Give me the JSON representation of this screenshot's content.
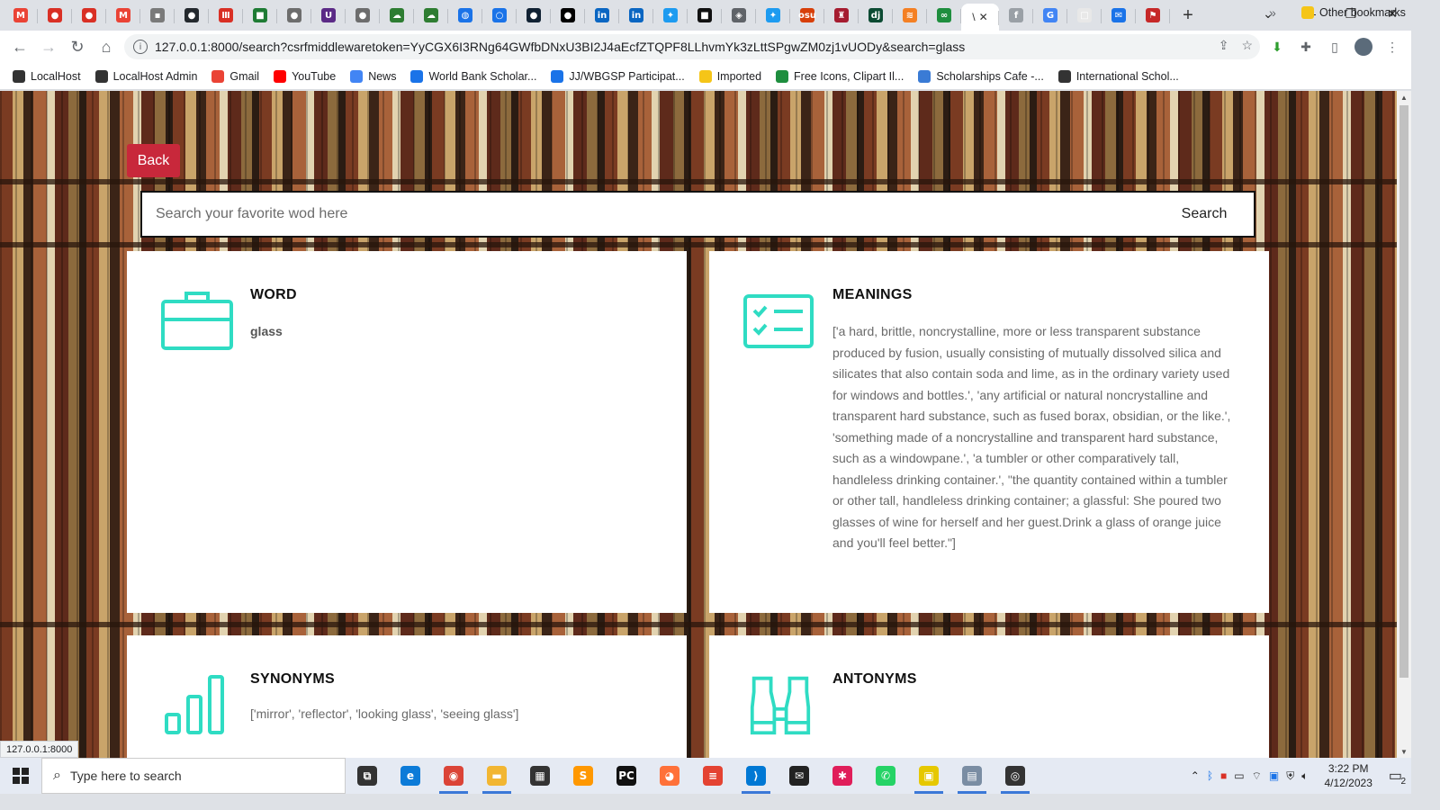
{
  "browser": {
    "tabs": [
      {
        "icon": "gmail-icon",
        "color": "#ea4335",
        "glyph": "M"
      },
      {
        "icon": "red-circle-icon",
        "color": "#d93025",
        "glyph": "●"
      },
      {
        "icon": "red-circle-icon",
        "color": "#d93025",
        "glyph": "●"
      },
      {
        "icon": "gmail-icon",
        "color": "#ea4335",
        "glyph": "M"
      },
      {
        "icon": "doc-icon",
        "color": "#7a7a7a",
        "glyph": "▪"
      },
      {
        "icon": "github-icon",
        "color": "#24292e",
        "glyph": "●"
      },
      {
        "icon": "bars-icon",
        "color": "#d93025",
        "glyph": "Ⅲ"
      },
      {
        "icon": "green-square-icon",
        "color": "#1e7b34",
        "glyph": "■"
      },
      {
        "icon": "gray-circle-icon",
        "color": "#6d6d6d",
        "glyph": "●"
      },
      {
        "icon": "u-icon",
        "color": "#5b2a86",
        "glyph": "U"
      },
      {
        "icon": "gray-circle-icon",
        "color": "#6d6d6d",
        "glyph": "●"
      },
      {
        "icon": "cloud-icon",
        "color": "#2e7d32",
        "glyph": "☁"
      },
      {
        "icon": "cloud-icon",
        "color": "#2e7d32",
        "glyph": "☁"
      },
      {
        "icon": "globe-icon",
        "color": "#1a73e8",
        "glyph": "◍"
      },
      {
        "icon": "blue-ring-icon",
        "color": "#1a73e8",
        "glyph": "○"
      },
      {
        "icon": "dark-circle-icon",
        "color": "#123",
        "glyph": "●"
      },
      {
        "icon": "medium-icon",
        "color": "#000",
        "glyph": "●"
      },
      {
        "icon": "linkedin-icon",
        "color": "#0a66c2",
        "glyph": "in"
      },
      {
        "icon": "linkedin-icon",
        "color": "#0a66c2",
        "glyph": "in"
      },
      {
        "icon": "twitter-icon",
        "color": "#1d9bf0",
        "glyph": "✦"
      },
      {
        "icon": "black-square-icon",
        "color": "#111",
        "glyph": "■"
      },
      {
        "icon": "shield-icon",
        "color": "#5f6368",
        "glyph": "◈"
      },
      {
        "icon": "twitter-icon",
        "color": "#1d9bf0",
        "glyph": "✦"
      },
      {
        "icon": "osu-icon",
        "color": "#d73f09",
        "glyph": "osu"
      },
      {
        "icon": "crest-icon",
        "color": "#a51c30",
        "glyph": "♜"
      },
      {
        "icon": "django-icon",
        "color": "#0c4b33",
        "glyph": "dj"
      },
      {
        "icon": "orange-icon",
        "color": "#f48024",
        "glyph": "≋"
      },
      {
        "icon": "green-link-icon",
        "color": "#1e8e3e",
        "glyph": "∞"
      }
    ],
    "active_tab": {
      "title": "\\",
      "close": "✕"
    },
    "tabs_after": [
      {
        "icon": "facebook-icon",
        "color": "#9aa0a6",
        "glyph": "f"
      },
      {
        "icon": "google-icon",
        "color": "#4285f4",
        "glyph": "G"
      },
      {
        "icon": "white-square-icon",
        "color": "#e8e8e8",
        "glyph": "□"
      },
      {
        "icon": "inbox-icon",
        "color": "#1a73e8",
        "glyph": "✉"
      },
      {
        "icon": "flag-icon",
        "color": "#c62828",
        "glyph": "⚑"
      }
    ],
    "new_tab": "+",
    "url": "127.0.0.1:8000/search?csrfmiddlewaretoken=YyCGX6I3RNg64GWfbDNxU3BI2J4aEcfZTQPF8LLhvmYk3zLttSPgwZM0zj1vUODy&search=glass",
    "status_url": "127.0.0.1:8000",
    "bookmarks": [
      {
        "label": "LocalHost",
        "color": "#333"
      },
      {
        "label": "LocalHost Admin",
        "color": "#333"
      },
      {
        "label": "Gmail",
        "color": "#ea4335"
      },
      {
        "label": "YouTube",
        "color": "#ff0000"
      },
      {
        "label": "News",
        "color": "#4285f4"
      },
      {
        "label": "World Bank Scholar...",
        "color": "#1a73e8"
      },
      {
        "label": "JJ/WBGSP Participat...",
        "color": "#1a73e8"
      },
      {
        "label": "Imported",
        "color": "#f5c518"
      },
      {
        "label": "Free Icons, Clipart Il...",
        "color": "#1e8e3e"
      },
      {
        "label": "Scholarships Cafe -...",
        "color": "#3a7bd5"
      },
      {
        "label": "International Schol...",
        "color": "#333"
      }
    ],
    "bookmarks_more": "»",
    "other_bookmarks": "Other bookmarks"
  },
  "page": {
    "back_label": "Back",
    "search": {
      "placeholder": "Search your favorite wod here",
      "button": "Search"
    },
    "accent_color": "#2fdcc3",
    "cards": {
      "word": {
        "title": "WORD",
        "value": "glass"
      },
      "meanings": {
        "title": "MEANINGS",
        "value": "['a hard, brittle, noncrystalline, more or less transparent substance produced by fusion, usually consisting of mutually dissolved silica and silicates that also contain soda and lime, as in the ordinary variety used for windows and bottles.', 'any artificial or natural noncrystalline and transparent hard substance, such as fused borax, obsidian, or the like.', 'something made of a noncrystalline and transparent hard substance, such as a windowpane.', 'a tumbler or other comparatively tall, handleless drinking container.', \"the quantity contained within a tumbler or other tall, handleless drinking container; a glassful: She poured two glasses of wine for herself and her guest.Drink a glass of orange juice and you'll feel better.\"]"
      },
      "synonyms": {
        "title": "SYNONYMS",
        "value": "['mirror', 'reflector', 'looking glass', 'seeing glass']"
      },
      "antonyms": {
        "title": "ANTONYMS",
        "value": ""
      }
    }
  },
  "taskbar": {
    "search_placeholder": "Type here to search",
    "time": "3:22 PM",
    "date": "4/12/2023",
    "notifications": "2",
    "apps": [
      {
        "name": "task-view-icon",
        "glyph": "⧉",
        "color": "#333",
        "running": false
      },
      {
        "name": "edge-icon",
        "glyph": "e",
        "color": "#0c7bd8",
        "running": false
      },
      {
        "name": "chrome-icon",
        "glyph": "◉",
        "color": "#db4437",
        "running": true
      },
      {
        "name": "file-explorer-icon",
        "glyph": "▬",
        "color": "#f2b632",
        "running": true
      },
      {
        "name": "store-icon",
        "glyph": "▦",
        "color": "#333",
        "running": false
      },
      {
        "name": "sublime-icon",
        "glyph": "S",
        "color": "#ff9800",
        "running": false
      },
      {
        "name": "pycharm-icon",
        "glyph": "PC",
        "color": "#111",
        "running": false
      },
      {
        "name": "firefox-icon",
        "glyph": "◕",
        "color": "#ff7139",
        "running": false
      },
      {
        "name": "todoist-icon",
        "glyph": "≡",
        "color": "#e44332",
        "running": false
      },
      {
        "name": "vscode-icon",
        "glyph": "⟩",
        "color": "#0078d4",
        "running": true
      },
      {
        "name": "mail-icon",
        "glyph": "✉",
        "color": "#222",
        "running": false
      },
      {
        "name": "slack-icon",
        "glyph": "✱",
        "color": "#e01e5a",
        "running": false
      },
      {
        "name": "whatsapp-icon",
        "glyph": "✆",
        "color": "#25d366",
        "running": false
      },
      {
        "name": "sticky-notes-icon",
        "glyph": "▣",
        "color": "#e6c800",
        "running": true
      },
      {
        "name": "photos-icon",
        "glyph": "▤",
        "color": "#7a8da3",
        "running": true
      },
      {
        "name": "obs-icon",
        "glyph": "◎",
        "color": "#333",
        "running": true
      }
    ]
  }
}
